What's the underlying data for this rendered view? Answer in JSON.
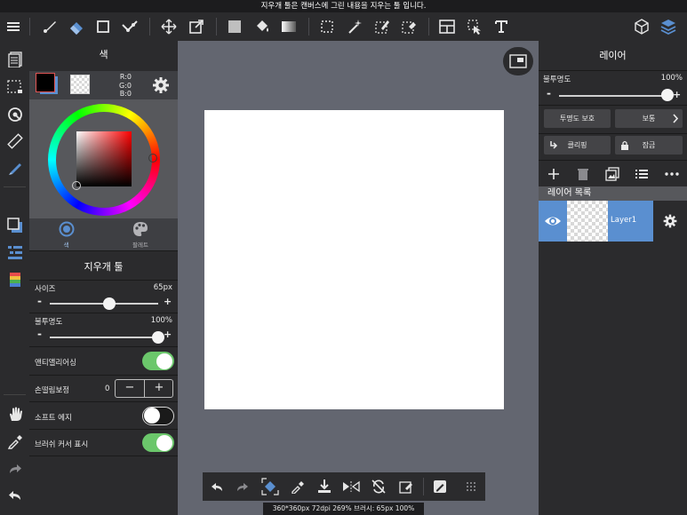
{
  "tip": "지우개 툴은 캔버스에 그린 내용을 지우는 툴 입니다.",
  "color_panel": {
    "title": "색",
    "rgb": {
      "r": "R:0",
      "g": "G:0",
      "b": "B:0"
    },
    "tabs": [
      {
        "label": "색",
        "icon": "color-wheel-icon"
      },
      {
        "label": "팔레트",
        "icon": "palette-icon"
      }
    ]
  },
  "tool_panel": {
    "title": "지우개 툴",
    "size": {
      "label": "사이즈",
      "value": "65px",
      "level": 0.55
    },
    "opacity": {
      "label": "불투명도",
      "value": "100%",
      "level": 1.0
    },
    "antialias": {
      "label": "앤티앨리어싱",
      "on": true
    },
    "stabilizer": {
      "label": "손떨림보정",
      "value": "0",
      "minus": "−",
      "plus": "+"
    },
    "soft_edge": {
      "label": "소프트 에지",
      "on": false
    },
    "cursor": {
      "label": "브러쉬 커서 표시",
      "on": true
    }
  },
  "layer_panel": {
    "title": "레이어",
    "opacity": {
      "label": "불투명도",
      "value": "100%",
      "level": 1.0
    },
    "protect_alpha": "투명도 보호",
    "blend_mode": "보통",
    "clipping": "클리핑",
    "lock": "잠금",
    "list_header": "레이어 목록",
    "layers": [
      {
        "name": "Layer1",
        "visible": true
      }
    ]
  },
  "status": "360*360px 72dpi 269% 브러시: 65px 100%",
  "colors": {
    "accent": "#5a8fd0",
    "toggle_on": "#6bc76b",
    "primary": "#000000"
  }
}
